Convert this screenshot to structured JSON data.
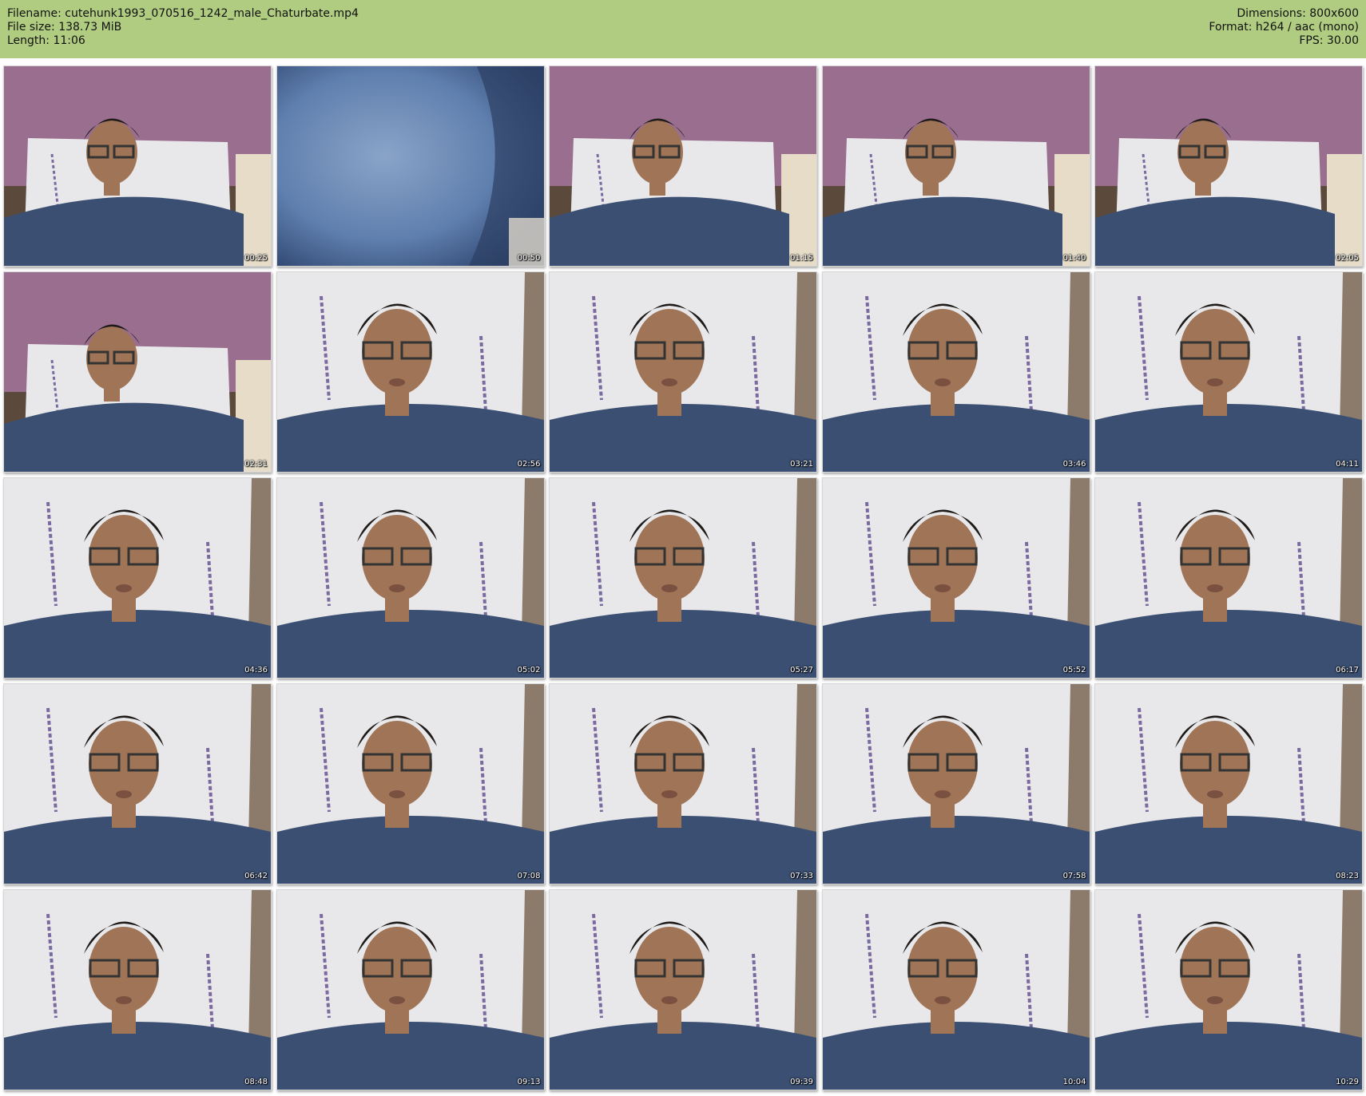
{
  "header": {
    "filename_line": "Filename: cutehunk1993_070516_1242_male_Chaturbate.mp4",
    "filesize_line": "File size: 138.73 MiB",
    "length_line": "Length: 11:06",
    "dimensions_line": "Dimensions: 800x600",
    "format_line": "Format: h264 / aac (mono)",
    "fps_line": "FPS: 30.00"
  },
  "colors": {
    "header_bg": "#b0cc80",
    "wall": "#9a6e8e",
    "pillow": "#e8e8ea",
    "shirt": "#3b4f72",
    "skin": "#a07456",
    "hair": "#1e1a18",
    "denim": "#5f7fae"
  },
  "thumbnails": [
    {
      "time": "00:25",
      "scene": "wide"
    },
    {
      "time": "00:50",
      "scene": "denim"
    },
    {
      "time": "01:15",
      "scene": "wide"
    },
    {
      "time": "01:40",
      "scene": "wide"
    },
    {
      "time": "02:05",
      "scene": "wide"
    },
    {
      "time": "02:31",
      "scene": "wide"
    },
    {
      "time": "02:56",
      "scene": "close"
    },
    {
      "time": "03:21",
      "scene": "close"
    },
    {
      "time": "03:46",
      "scene": "close"
    },
    {
      "time": "04:11",
      "scene": "close"
    },
    {
      "time": "04:36",
      "scene": "close"
    },
    {
      "time": "05:02",
      "scene": "close"
    },
    {
      "time": "05:27",
      "scene": "close"
    },
    {
      "time": "05:52",
      "scene": "close"
    },
    {
      "time": "06:17",
      "scene": "close"
    },
    {
      "time": "06:42",
      "scene": "close"
    },
    {
      "time": "07:08",
      "scene": "close"
    },
    {
      "time": "07:33",
      "scene": "close"
    },
    {
      "time": "07:58",
      "scene": "close"
    },
    {
      "time": "08:23",
      "scene": "close"
    },
    {
      "time": "08:48",
      "scene": "close"
    },
    {
      "time": "09:13",
      "scene": "close"
    },
    {
      "time": "09:39",
      "scene": "close"
    },
    {
      "time": "10:04",
      "scene": "close"
    },
    {
      "time": "10:29",
      "scene": "close"
    }
  ]
}
